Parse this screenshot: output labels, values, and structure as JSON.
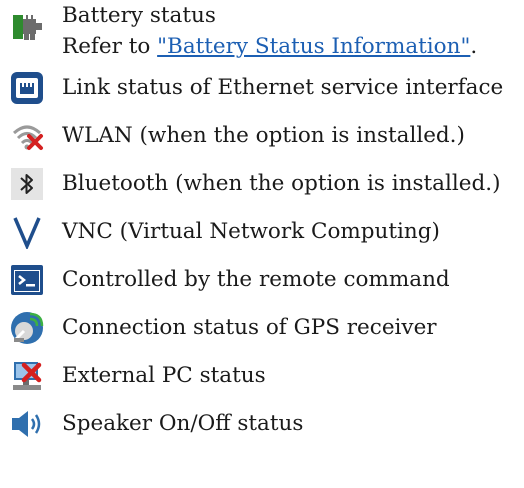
{
  "items": [
    {
      "icon": "battery-status-icon",
      "label": "Battery status",
      "note_prefix": "Refer to ",
      "link_text": "\"Battery Status Information\"",
      "note_suffix": "."
    },
    {
      "icon": "ethernet-link-icon",
      "label": "Link status of Ethernet service interface"
    },
    {
      "icon": "wlan-disconnected-icon",
      "label": "WLAN (when the option is installed.)"
    },
    {
      "icon": "bluetooth-icon",
      "label": "Bluetooth (when the option is installed.)"
    },
    {
      "icon": "vnc-icon",
      "label": "VNC (Virtual Network Computing)"
    },
    {
      "icon": "remote-command-icon",
      "label": "Controlled by the remote command"
    },
    {
      "icon": "gps-receiver-icon",
      "label": "Connection status of GPS receiver"
    },
    {
      "icon": "external-pc-icon",
      "label": "External PC status"
    },
    {
      "icon": "speaker-icon",
      "label": "Speaker On/Off status"
    }
  ],
  "colors": {
    "link": "#1c5fb3",
    "icon_blue": "#1f4e8c",
    "battery_green": "#2e8b2e",
    "alert_red": "#d42020"
  }
}
